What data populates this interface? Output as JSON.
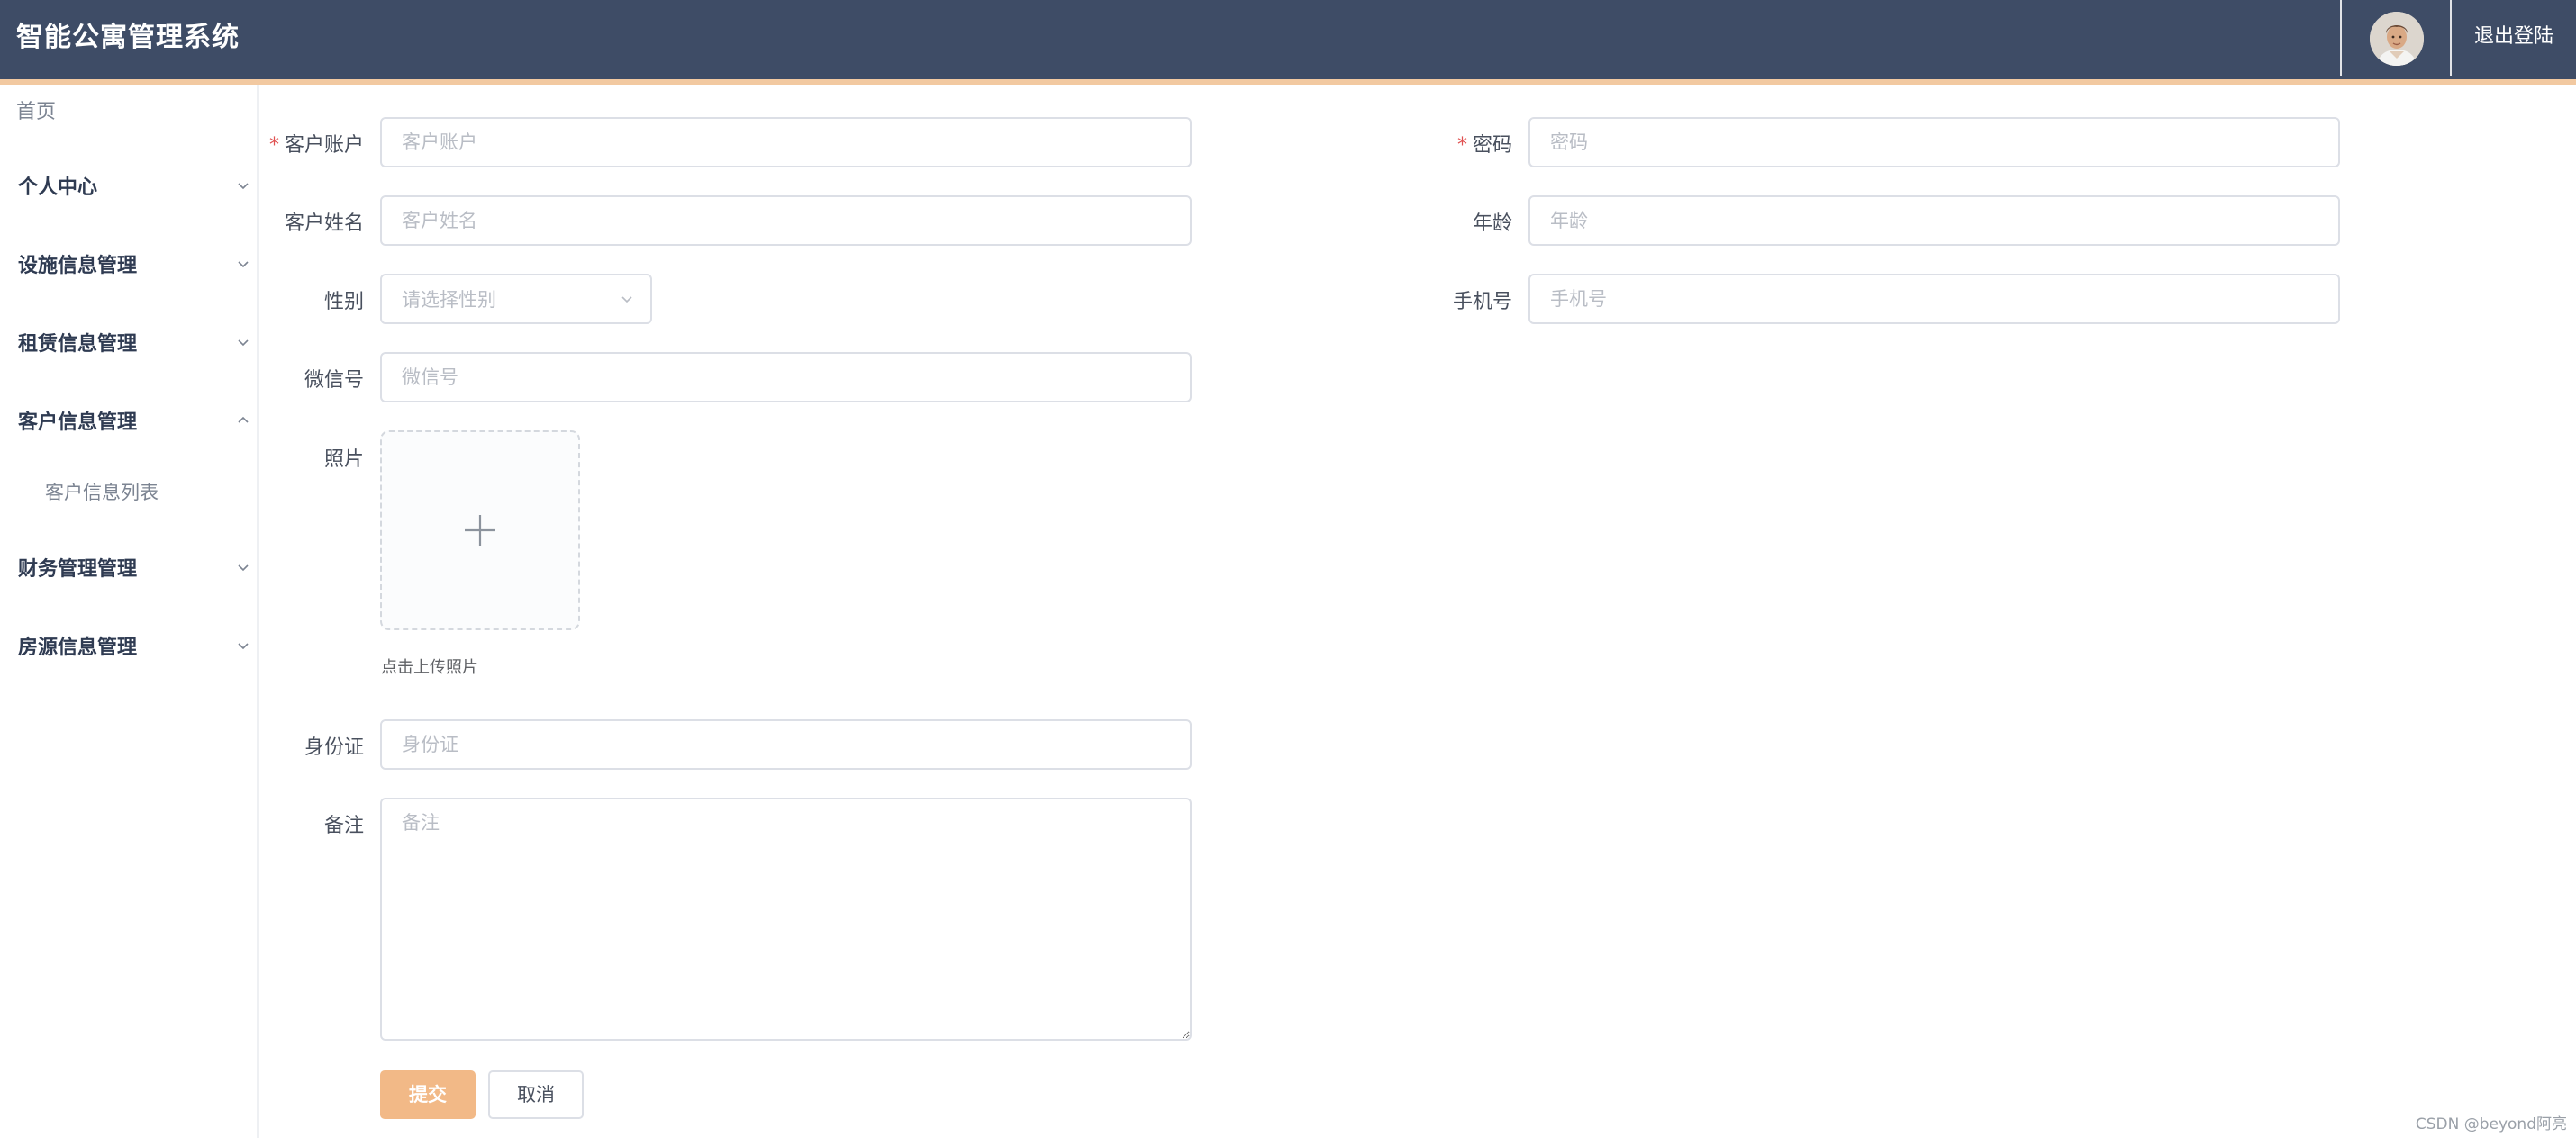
{
  "header": {
    "title": "智能公寓管理系统",
    "logout_label": "退出登陆"
  },
  "sidebar": {
    "home": "首页",
    "items": [
      {
        "label": "个人中心",
        "expanded": false
      },
      {
        "label": "设施信息管理",
        "expanded": false
      },
      {
        "label": "租赁信息管理",
        "expanded": false
      },
      {
        "label": "客户信息管理",
        "expanded": true,
        "children": [
          {
            "label": "客户信息列表"
          }
        ]
      },
      {
        "label": "财务管理管理",
        "expanded": false
      },
      {
        "label": "房源信息管理",
        "expanded": false
      }
    ]
  },
  "form": {
    "account": {
      "label": "客户账户",
      "placeholder": "客户账户",
      "required": true
    },
    "password": {
      "label": "密码",
      "placeholder": "密码",
      "required": true
    },
    "name": {
      "label": "客户姓名",
      "placeholder": "客户姓名"
    },
    "age": {
      "label": "年龄",
      "placeholder": "年龄"
    },
    "gender": {
      "label": "性别",
      "placeholder": "请选择性别"
    },
    "phone": {
      "label": "手机号",
      "placeholder": "手机号"
    },
    "wechat": {
      "label": "微信号",
      "placeholder": "微信号"
    },
    "photo": {
      "label": "照片",
      "tip": "点击上传照片"
    },
    "id_card": {
      "label": "身份证",
      "placeholder": "身份证"
    },
    "remark": {
      "label": "备注",
      "placeholder": "备注"
    },
    "submit_label": "提交",
    "cancel_label": "取消"
  },
  "watermark": "CSDN @beyond阿亮",
  "colors": {
    "header_bg": "#3e4c66",
    "header_strip": "#f2c9a1",
    "submit_bg": "#f2b987",
    "required_mark": "#e05252"
  },
  "icons": {
    "avatar": "user-avatar-photo",
    "chevron_down": "chevron-down-icon",
    "chevron_up": "chevron-up-icon",
    "plus": "plus-icon"
  }
}
